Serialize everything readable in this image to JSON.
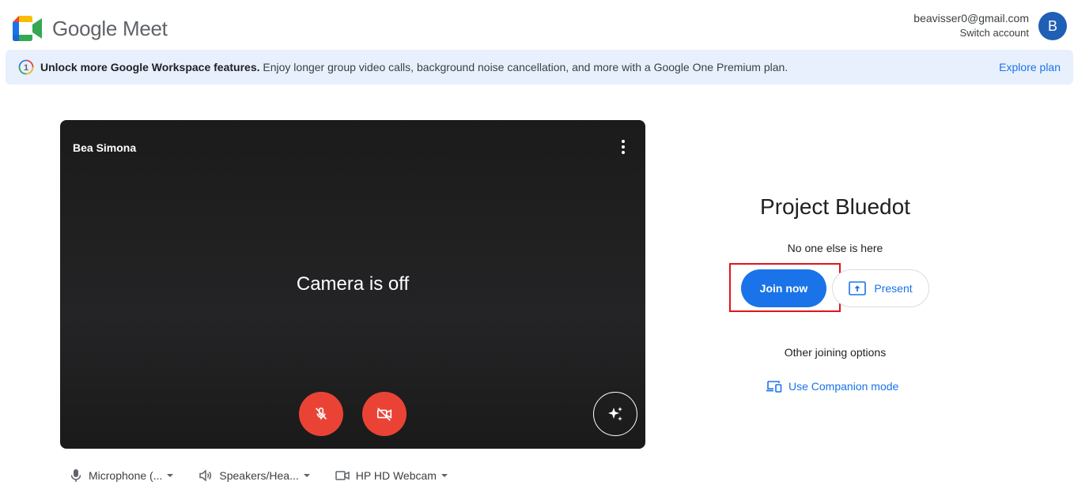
{
  "app": {
    "name": "Google Meet"
  },
  "account": {
    "email": "beavisser0@gmail.com",
    "switch_label": "Switch account",
    "avatar_letter": "B"
  },
  "banner": {
    "title": "Unlock more Google Workspace features.",
    "text": " Enjoy longer group video calls, background noise cancellation, and more with a Google One Premium plan.",
    "link_label": "Explore plan"
  },
  "preview": {
    "user_name": "Bea Simona",
    "camera_status": "Camera is off",
    "more_icon": "more-vert-icon",
    "mic_icon": "mic-off-icon",
    "cam_icon": "videocam-off-icon",
    "effects_icon": "sparkle-effects-icon"
  },
  "devices": {
    "microphone": "Microphone (...",
    "speakers": "Speakers/Hea...",
    "camera": "HP HD Webcam"
  },
  "meeting": {
    "title": "Project Bluedot",
    "status": "No one else is here",
    "join_label": "Join now",
    "present_label": "Present",
    "other_options_label": "Other joining options",
    "companion_label": "Use Companion mode"
  },
  "colors": {
    "accent": "#1a73e8",
    "danger": "#ea4335",
    "banner_bg": "#e8f0fe",
    "highlight": "#e0141a"
  }
}
